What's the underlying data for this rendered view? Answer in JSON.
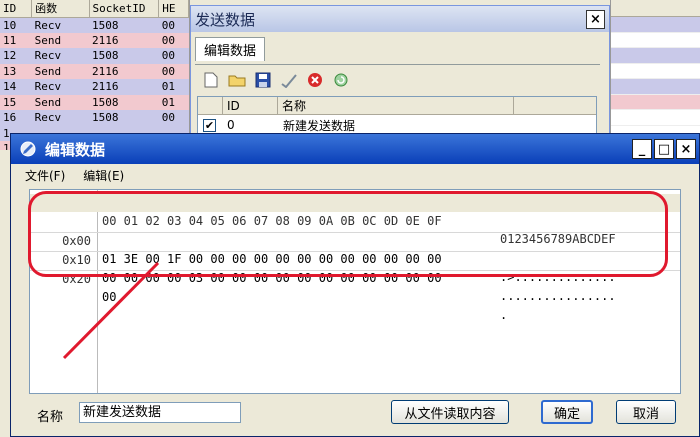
{
  "bg_table": {
    "headers": [
      "ID",
      "函数",
      "SocketID",
      "HE"
    ],
    "rows": [
      {
        "id": "10",
        "func": "Recv",
        "socket": "1508",
        "he": "00",
        "type": "recv"
      },
      {
        "id": "11",
        "func": "Send",
        "socket": "2116",
        "he": "00",
        "type": "send"
      },
      {
        "id": "12",
        "func": "Recv",
        "socket": "1508",
        "he": "00",
        "type": "recv"
      },
      {
        "id": "13",
        "func": "Send",
        "socket": "2116",
        "he": "00",
        "type": "send"
      },
      {
        "id": "14",
        "func": "Recv",
        "socket": "2116",
        "he": "01",
        "type": "recv"
      },
      {
        "id": "15",
        "func": "Send",
        "socket": "1508",
        "he": "01",
        "type": "send"
      },
      {
        "id": "16",
        "func": "Recv",
        "socket": "1508",
        "he": "00",
        "type": "recv"
      },
      {
        "id": "1",
        "func": "",
        "socket": "",
        "he": "",
        "type": "recv"
      },
      {
        "id": "1",
        "func": "",
        "socket": "",
        "he": "",
        "type": "send"
      }
    ]
  },
  "send_dialog": {
    "title": "发送数据",
    "close": "×",
    "tab": "编辑数据",
    "list_headers": {
      "id": "ID",
      "name": "名称"
    },
    "list_row": {
      "id": "0",
      "name": "新建发送数据",
      "checked": "✔"
    }
  },
  "edit_window": {
    "title": "编辑数据",
    "menu": {
      "file": "文件(F)",
      "edit": "编辑(E)"
    },
    "controls": {
      "minimize": "_",
      "maximize": "□",
      "close": "×"
    },
    "hex": {
      "header_bytes": "00 01 02 03 04 05 06 07 08 09 0A 0B 0C 0D 0E 0F",
      "header_ascii": "0123456789ABCDEF",
      "rows": [
        {
          "offset": "0x00",
          "bytes": "01 3E 00 1F 00 00 00 00 00 00 00 00 00 00 00 00",
          "ascii": ".>.............."
        },
        {
          "offset": "0x10",
          "bytes": "00 00 00 00 03 00 00 00 00 00 00 00 00 00 00 00",
          "ascii": "................"
        },
        {
          "offset": "0x20",
          "bytes": "00",
          "ascii": "."
        }
      ]
    },
    "name_label": "名称",
    "name_value": "新建发送数据",
    "buttons": {
      "load": "从文件读取内容",
      "ok": "确定",
      "cancel": "取消"
    }
  },
  "colors": {
    "recv_row": "#c9c9e9",
    "send_row": "#f2c9cf",
    "highlight": "#e0192e",
    "title_blue": "#0a3fb8"
  }
}
